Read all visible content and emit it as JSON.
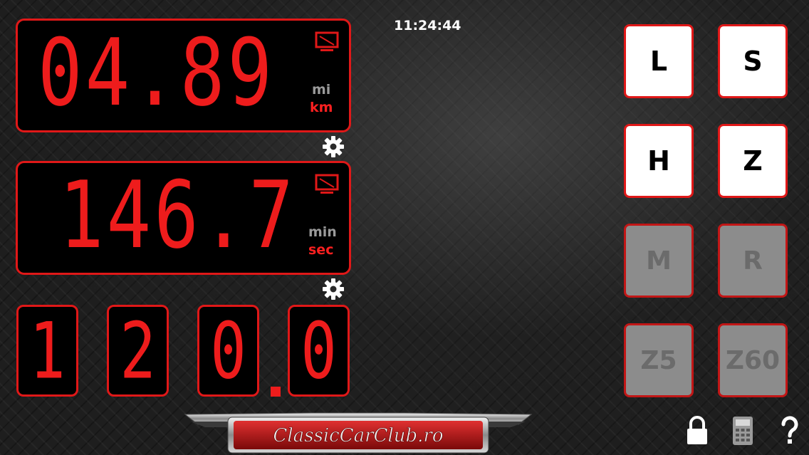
{
  "clock": {
    "time": "11:24:44"
  },
  "distance_display": {
    "value": "04.89",
    "unit_inactive": "mi",
    "unit_active": "km"
  },
  "time_display": {
    "value": "146.7",
    "unit_inactive": "min",
    "unit_active": "sec"
  },
  "counter": {
    "digits": [
      "1",
      "2",
      "0",
      "0"
    ]
  },
  "buttons": {
    "L": "L",
    "S": "S",
    "H": "H",
    "Z": "Z",
    "M": "M",
    "R": "R",
    "Z5": "Z5",
    "Z60": "Z60"
  },
  "logo": {
    "text": "ClassicCarClub.ro"
  },
  "icons": {
    "screen": "monitor-icon",
    "settings": "gear-icon",
    "lock": "lock-icon",
    "calculator": "calculator-icon",
    "help": "help-icon"
  },
  "colors": {
    "accent": "#e01818",
    "digit": "#ee1c1c",
    "button_active_bg": "#ffffff",
    "button_disabled_bg": "#8c8c8c"
  }
}
